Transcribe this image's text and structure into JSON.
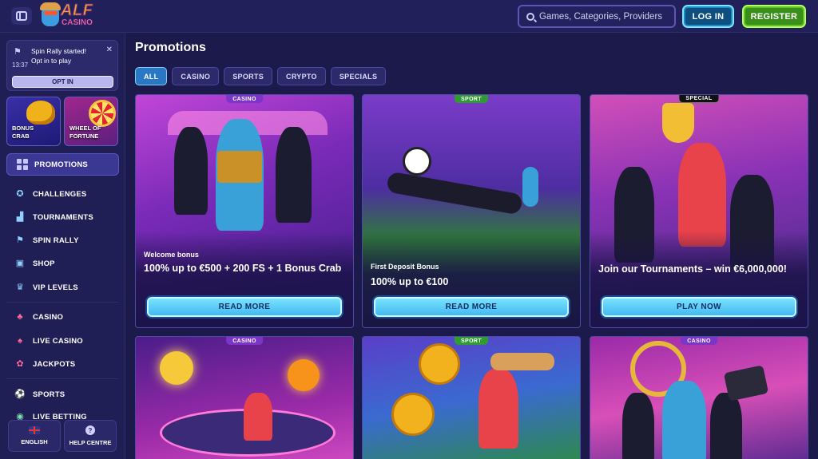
{
  "header": {
    "logo_text": "ALF",
    "logo_sub": "CASINO",
    "search_placeholder": "Games, Categories, Providers",
    "login_label": "LOG IN",
    "register_label": "REGISTER"
  },
  "notification": {
    "title": "Spin Rally started!",
    "subtitle": "Opt in to play",
    "time": "13:37",
    "button": "OPT IN"
  },
  "features": [
    {
      "label": "BONUS\nCRAB"
    },
    {
      "label": "WHEEL OF\nFORTUNE"
    }
  ],
  "sidebar": {
    "active": "PROMOTIONS",
    "items": [
      {
        "label": "CHALLENGES",
        "icon": "badge-icon"
      },
      {
        "label": "TOURNAMENTS",
        "icon": "podium-icon"
      },
      {
        "label": "SPIN RALLY",
        "icon": "flag-icon"
      },
      {
        "label": "SHOP",
        "icon": "bag-icon"
      },
      {
        "label": "VIP LEVELS",
        "icon": "crown-icon"
      },
      {
        "label": "CASINO",
        "icon": "cherry-icon"
      },
      {
        "label": "LIVE CASINO",
        "icon": "cards-icon"
      },
      {
        "label": "JACKPOTS",
        "icon": "clover-icon"
      },
      {
        "label": "SPORTS",
        "icon": "ball-icon"
      },
      {
        "label": "LIVE BETTING",
        "icon": "live-icon"
      }
    ],
    "language": "ENGLISH",
    "help": "HELP CENTRE"
  },
  "main": {
    "title": "Promotions",
    "tabs": [
      "ALL",
      "CASINO",
      "SPORTS",
      "CRYPTO",
      "SPECIALS"
    ],
    "active_tab": "ALL",
    "cards": [
      {
        "badge": "CASINO",
        "kicker": "Welcome bonus",
        "headline": "100% up to €500 + 200 FS + 1 Bonus Crab",
        "cta": "READ MORE"
      },
      {
        "badge": "SPORT",
        "kicker": "First Deposit Bonus",
        "headline": "100% up to €100",
        "cta": "READ MORE"
      },
      {
        "badge": "SPECIAL",
        "kicker": "",
        "headline": "Join our Tournaments – win €6,000,000!",
        "cta": "PLAY NOW"
      },
      {
        "badge": "CASINO",
        "kicker": "",
        "headline": "",
        "cta": ""
      },
      {
        "badge": "SPORT",
        "kicker": "",
        "headline": "",
        "cta": ""
      },
      {
        "badge": "CASINO",
        "kicker": "",
        "headline": "",
        "cta": ""
      }
    ]
  },
  "colors": {
    "background": "#1b1a4a",
    "accent_blue": "#2a78c4",
    "register_green": "#3a8f1a",
    "cta_cyan": "#7ee6ff"
  }
}
